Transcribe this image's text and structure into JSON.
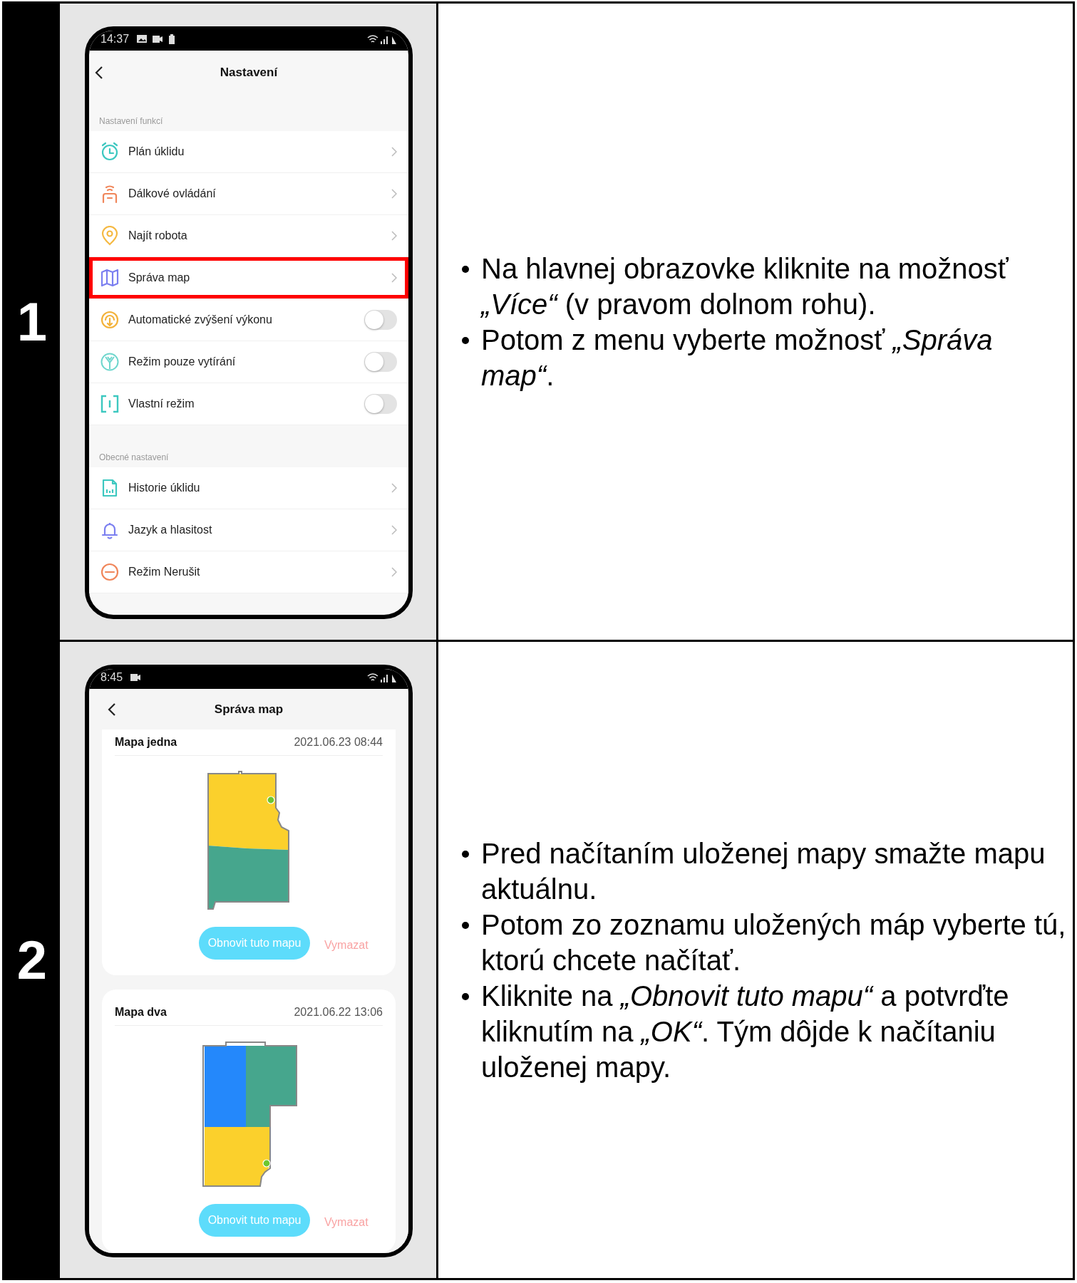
{
  "steps": [
    {
      "number": "1",
      "phone": {
        "kind": "settings",
        "status_time": "14:37",
        "title": "Nastavení",
        "sections": [
          {
            "label": "Nastavení funkcí",
            "items": [
              {
                "label": "Plán úklidu",
                "kind": "link",
                "highlighted": false
              },
              {
                "label": "Dálkové ovládání",
                "kind": "link",
                "highlighted": false
              },
              {
                "label": "Najít robota",
                "kind": "link",
                "highlighted": false
              },
              {
                "label": "Správa map",
                "kind": "link",
                "highlighted": true
              },
              {
                "label": "Automatické zvýšení výkonu",
                "kind": "toggle",
                "on": false,
                "highlighted": false
              },
              {
                "label": "Režim pouze vytírání",
                "kind": "toggle",
                "on": false,
                "highlighted": false
              },
              {
                "label": "Vlastní režim",
                "kind": "toggle",
                "on": false,
                "highlighted": false
              }
            ]
          },
          {
            "label": "Obecné nastavení",
            "items": [
              {
                "label": "Historie úklidu",
                "kind": "link",
                "highlighted": false
              },
              {
                "label": "Jazyk a hlasitost",
                "kind": "link",
                "highlighted": false
              },
              {
                "label": "Režim Nerušit",
                "kind": "link",
                "highlighted": false
              }
            ]
          }
        ]
      },
      "instructions": [
        "Na hlavnej obrazovke kliknite na možnosť *„Více“* (v pravom dolnom rohu).",
        "Potom z menu vyberte možnosť *„Správa map“*."
      ]
    },
    {
      "number": "2",
      "phone": {
        "kind": "maps",
        "status_time": "8:45",
        "title": "Správa map",
        "maps": [
          {
            "name": "Mapa jedna",
            "date": "2021.06.23 08:44",
            "restore_button": "Obnovit tuto mapu",
            "delete_button": "Vymazat"
          },
          {
            "name": "Mapa dva",
            "date": "2021.06.22 13:06",
            "restore_button": "Obnovit tuto mapu",
            "delete_button": "Vymazat"
          }
        ]
      },
      "instructions": [
        "Pred načítaním uloženej mapy smažte mapu aktuálnu.",
        "Potom zo zoznamu uložených máp vyberte tú, ktorú chcete načítať.",
        "Kliknite na *„Obnovit tuto mapu“* a potvrďte kliknutím na *„OK“*. Tým dôjde k načítaniu uloženej mapy."
      ]
    }
  ]
}
